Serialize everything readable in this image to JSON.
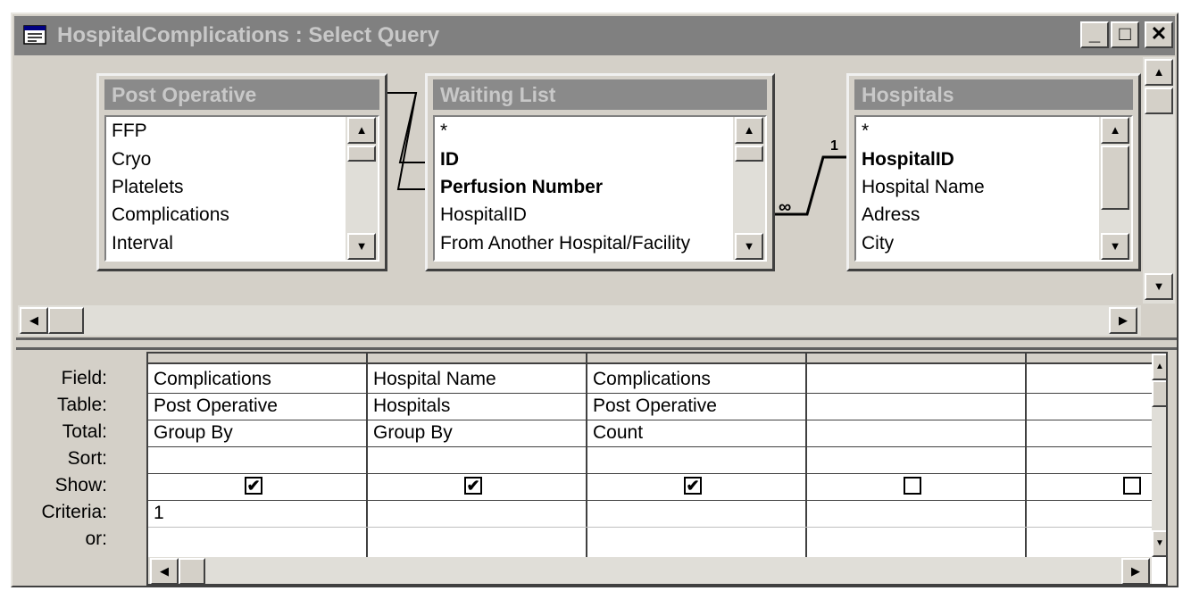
{
  "window": {
    "title": "HospitalComplications : Select Query",
    "buttons": {
      "minimize": "_",
      "maximize": "□",
      "close": "✕"
    }
  },
  "tables": [
    {
      "title": "Post Operative",
      "fields": [
        "FFP",
        "Cryo",
        "Platelets",
        "Complications",
        "Interval"
      ],
      "bold": []
    },
    {
      "title": "Waiting List",
      "fields": [
        "*",
        "ID",
        "Perfusion Number",
        "HospitalID",
        "From Another Hospital/Facility"
      ],
      "bold": [
        "ID",
        "Perfusion Number"
      ]
    },
    {
      "title": "Hospitals",
      "fields": [
        "*",
        "HospitalID",
        "Hospital Name",
        "Adress",
        "City"
      ],
      "bold": [
        "HospitalID"
      ]
    }
  ],
  "relationship": {
    "one": "1",
    "many": "∞"
  },
  "grid": {
    "row_labels": [
      "Field:",
      "Table:",
      "Total:",
      "Sort:",
      "Show:",
      "Criteria:",
      "or:"
    ],
    "columns": [
      {
        "field": "Complications",
        "table": "Post Operative",
        "total": "Group By",
        "sort": "",
        "show": true,
        "criteria": "1",
        "or": ""
      },
      {
        "field": "Hospital Name",
        "table": "Hospitals",
        "total": "Group By",
        "sort": "",
        "show": true,
        "criteria": "",
        "or": ""
      },
      {
        "field": "Complications",
        "table": "Post Operative",
        "total": "Count",
        "sort": "",
        "show": true,
        "criteria": "",
        "or": ""
      },
      {
        "field": "",
        "table": "",
        "total": "",
        "sort": "",
        "show": false,
        "criteria": "",
        "or": ""
      },
      {
        "field": "",
        "table": "",
        "total": "",
        "sort": "",
        "show": false,
        "criteria": "",
        "or": ""
      }
    ]
  },
  "glyphs": {
    "up": "▲",
    "down": "▼",
    "left": "◀",
    "right": "▶",
    "check": "✔"
  },
  "colors": {
    "face": "#d4d0c8",
    "title_inactive": "#808080",
    "title_text": "#c8c8c8"
  }
}
